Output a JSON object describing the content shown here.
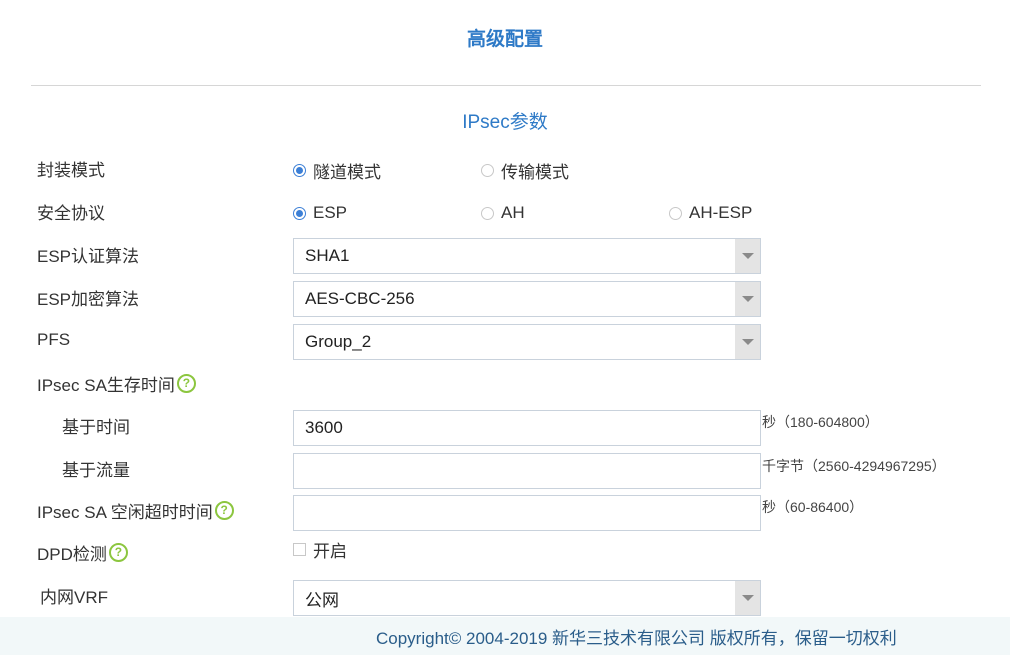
{
  "header": {
    "title": "高级配置"
  },
  "section": {
    "title": "IPsec参数"
  },
  "encap_mode": {
    "label": "封装模式",
    "options": [
      {
        "label": "隧道模式",
        "checked": true
      },
      {
        "label": "传输模式",
        "checked": false
      }
    ]
  },
  "security_protocol": {
    "label": "安全协议",
    "options": [
      {
        "label": "ESP",
        "checked": true
      },
      {
        "label": "AH",
        "checked": false
      },
      {
        "label": "AH-ESP",
        "checked": false
      }
    ]
  },
  "esp_auth": {
    "label": "ESP认证算法",
    "value": "SHA1"
  },
  "esp_encrypt": {
    "label": "ESP加密算法",
    "value": "AES-CBC-256"
  },
  "pfs": {
    "label": "PFS",
    "value": "Group_2"
  },
  "sa_lifetime": {
    "label": "IPsec SA生存时间",
    "time": {
      "label": "基于时间",
      "value": "3600",
      "hint": "秒（180-604800）"
    },
    "traffic": {
      "label": "基于流量",
      "value": "",
      "hint": "千字节（2560-4294967295）"
    }
  },
  "sa_idle": {
    "label": "IPsec SA 空闲超时时间",
    "value": "",
    "hint": "秒（60-86400）"
  },
  "dpd": {
    "label": "DPD检测",
    "option_label": "开启",
    "checked": false
  },
  "vrf": {
    "label": "内网VRF",
    "value": "公网"
  },
  "footer": {
    "copyright": "Copyright© 2004-2019 新华三技术有限公司 版权所有，保留一切权利"
  },
  "icons": {
    "help": "help-question-icon",
    "dropdown": "chevron-down-icon"
  },
  "colors": {
    "accent": "#2e7ac7",
    "help": "#8cc63f",
    "radio": "#3c7fd6",
    "footer_bg": "#f2f8f9"
  }
}
